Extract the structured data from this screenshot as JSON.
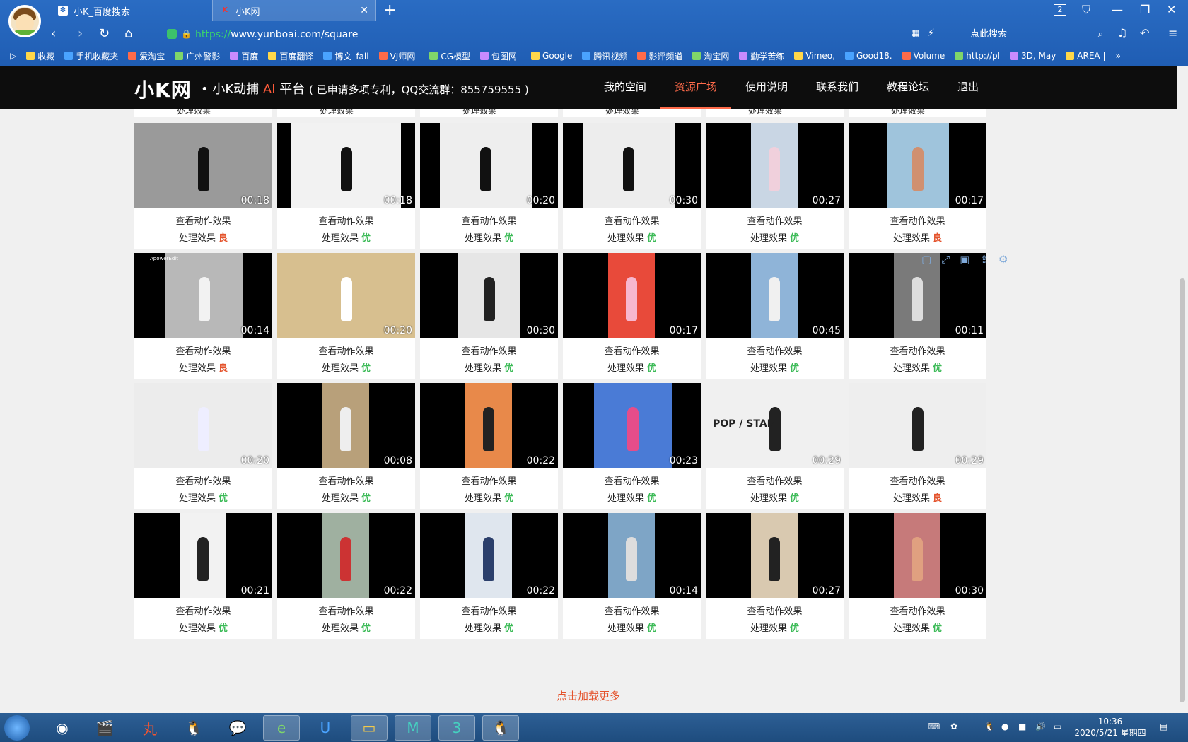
{
  "browser": {
    "tabs": [
      {
        "label": "小K_百度搜索",
        "icon": "paw"
      },
      {
        "label": "小K网",
        "icon": "k-logo"
      }
    ],
    "window_badge": "2",
    "url_scheme": "https://",
    "url_rest": "www.yunboai.com/square",
    "search_placeholder": "点此搜索",
    "bookmarks": [
      "收藏",
      "手机收藏夹",
      "爱淘宝",
      "广州警影",
      "百度",
      "百度翻译",
      "博文_fall",
      "VJ师网_",
      "CG模型",
      "包图网_",
      "Google",
      "腾讯视频",
      "影评频道",
      "淘宝网",
      "勤学苦练",
      "Vimeo,",
      "Good18.",
      "Volume",
      "http://pl",
      "3D, May",
      "AREA |"
    ]
  },
  "site": {
    "logo_text": "小K网",
    "tagline_pre": "小K动捕",
    "tagline_ai": "AI",
    "tagline_post": "平台",
    "tagline_small": "( 已申请多项专利，QQ交流群：855759555 )",
    "menu": [
      {
        "label": "我的空间",
        "active": false
      },
      {
        "label": "资源广场",
        "active": true
      },
      {
        "label": "使用说明",
        "active": false
      },
      {
        "label": "联系我们",
        "active": false
      },
      {
        "label": "教程论坛",
        "active": false
      },
      {
        "label": "退出",
        "active": false
      }
    ],
    "view_label": "查看动作效果",
    "effect_label": "处理效果",
    "load_more": "点击加载更多",
    "partial_label": "处理效果",
    "rows": [
      [
        {
          "dur": "00:18",
          "q": "良",
          "kind": "ok"
        },
        {
          "dur": "00:18",
          "q": "优",
          "kind": "good"
        },
        {
          "dur": "00:20",
          "q": "优",
          "kind": "good"
        },
        {
          "dur": "00:30",
          "q": "优",
          "kind": "good"
        },
        {
          "dur": "00:27",
          "q": "优",
          "kind": "good"
        },
        {
          "dur": "00:17",
          "q": "良",
          "kind": "ok"
        }
      ],
      [
        {
          "dur": "00:14",
          "q": "良",
          "kind": "ok"
        },
        {
          "dur": "00:20",
          "q": "优",
          "kind": "good"
        },
        {
          "dur": "00:30",
          "q": "优",
          "kind": "good"
        },
        {
          "dur": "00:17",
          "q": "优",
          "kind": "good"
        },
        {
          "dur": "00:45",
          "q": "优",
          "kind": "good"
        },
        {
          "dur": "00:11",
          "q": "优",
          "kind": "good"
        }
      ],
      [
        {
          "dur": "00:20",
          "q": "优",
          "kind": "good"
        },
        {
          "dur": "00:08",
          "q": "优",
          "kind": "good"
        },
        {
          "dur": "00:22",
          "q": "优",
          "kind": "good"
        },
        {
          "dur": "00:23",
          "q": "优",
          "kind": "good"
        },
        {
          "dur": "00:29",
          "q": "优",
          "kind": "good"
        },
        {
          "dur": "00:29",
          "q": "良",
          "kind": "ok"
        }
      ],
      [
        {
          "dur": "00:21",
          "q": "优",
          "kind": "good"
        },
        {
          "dur": "00:22",
          "q": "优",
          "kind": "good"
        },
        {
          "dur": "00:22",
          "q": "优",
          "kind": "good"
        },
        {
          "dur": "00:14",
          "q": "优",
          "kind": "good"
        },
        {
          "dur": "00:27",
          "q": "优",
          "kind": "good"
        },
        {
          "dur": "00:30",
          "q": "优",
          "kind": "good"
        }
      ]
    ],
    "thumb_text_pop": "POP / STARS",
    "thumb_text_apower": "ApowerEdit"
  },
  "taskbar": {
    "time": "10:36",
    "date": "2020/5/21 星期四"
  }
}
